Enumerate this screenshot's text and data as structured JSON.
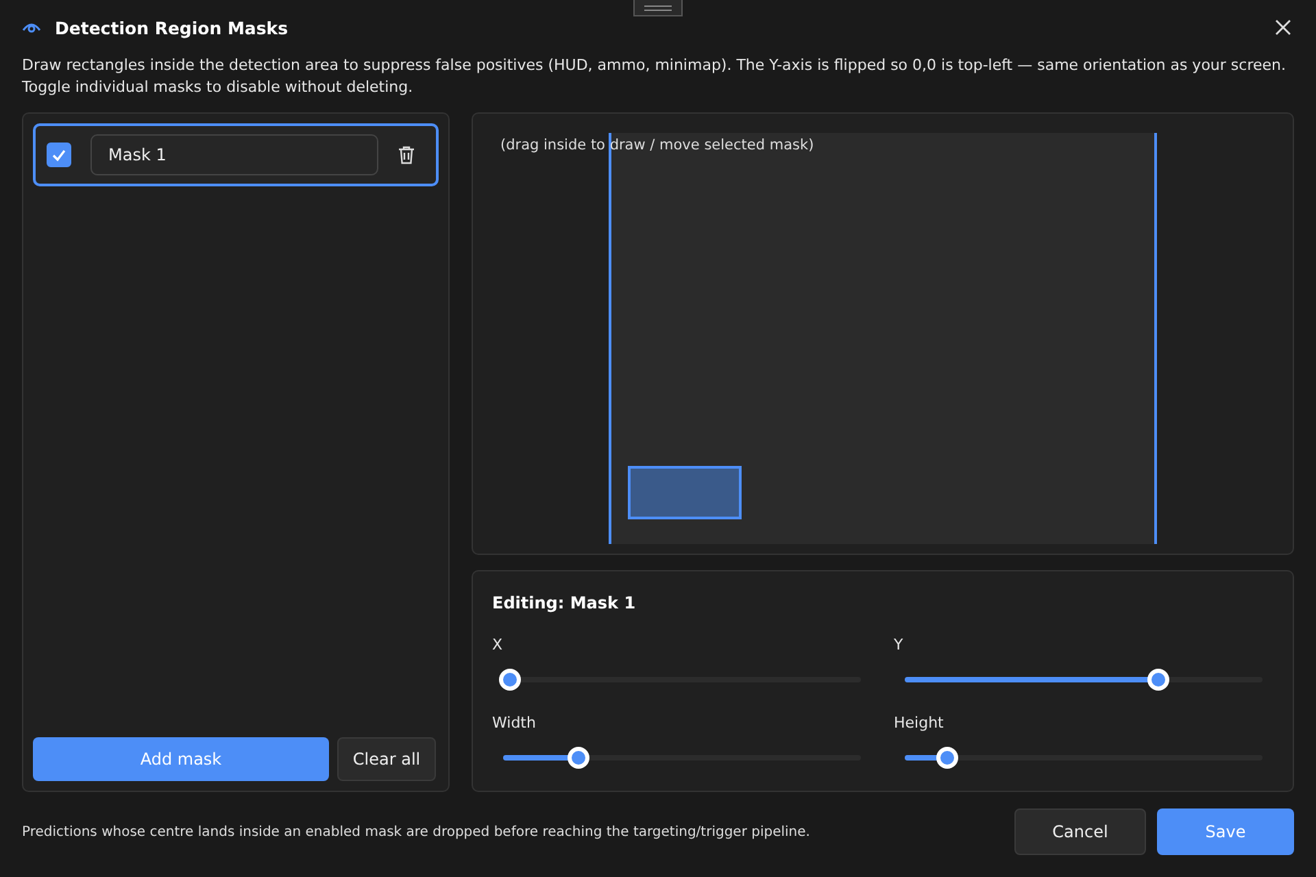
{
  "window": {
    "title": "Detection Region Masks"
  },
  "description": "Draw rectangles inside the detection area to suppress false positives (HUD, ammo, minimap). The Y-axis is flipped so 0,0 is top-left — same orientation as your screen. Toggle individual masks to disable without deleting.",
  "masks": [
    {
      "name": "Mask 1",
      "enabled": true,
      "selected": true
    }
  ],
  "list_buttons": {
    "add": "Add mask",
    "clear": "Clear all"
  },
  "canvas": {
    "hint": "(drag inside to draw / move selected mask)"
  },
  "editor": {
    "title": "Editing: Mask 1",
    "sliders": [
      {
        "label": "X",
        "level": 0.02
      },
      {
        "label": "Y",
        "level": 0.71
      },
      {
        "label": "Width",
        "level": 0.21
      },
      {
        "label": "Height",
        "level": 0.12
      }
    ]
  },
  "footer": {
    "note": "Predictions whose centre lands inside an enabled mask are dropped before reaching the targeting/trigger pipeline.",
    "cancel": "Cancel",
    "save": "Save"
  }
}
